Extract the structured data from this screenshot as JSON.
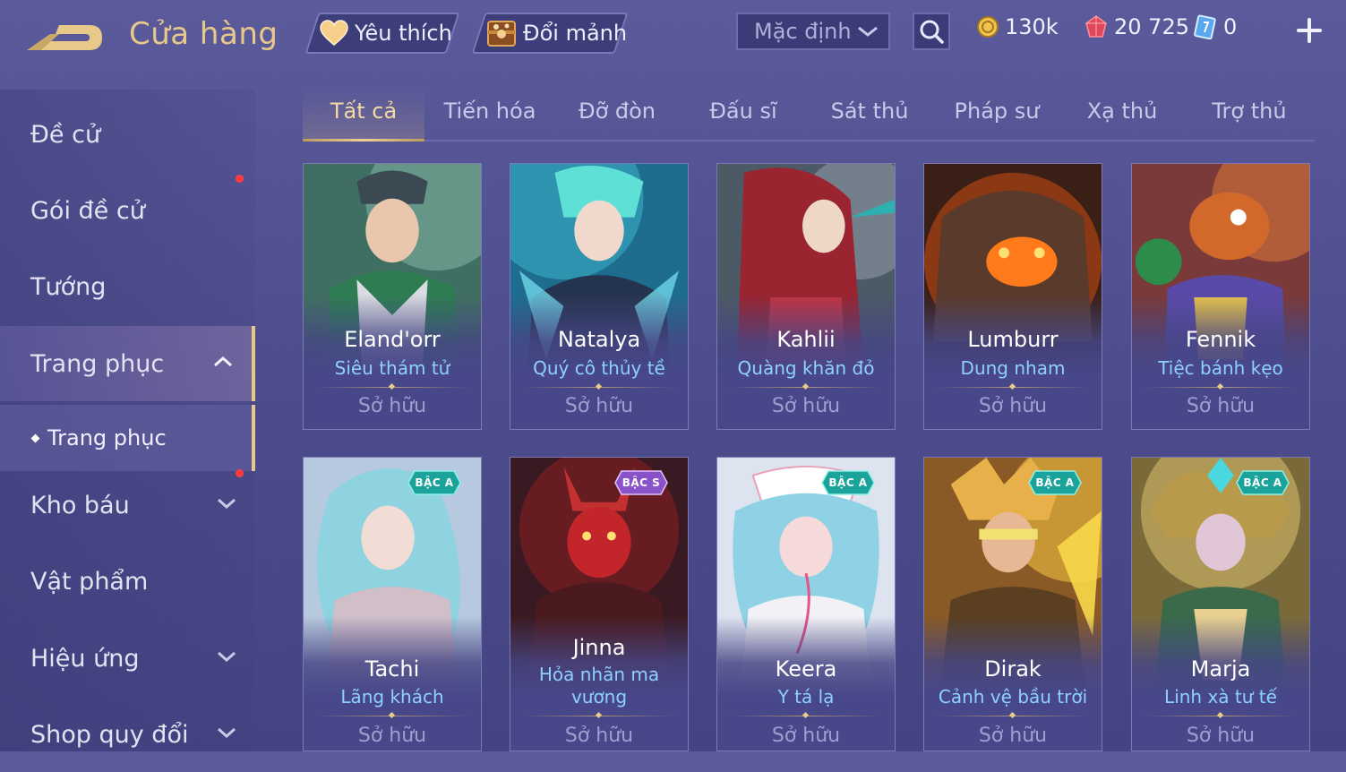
{
  "header": {
    "title": "Cửa hàng",
    "favorite_label": "Yêu thích",
    "exchange_label": "Đổi mảnh",
    "sort_value": "Mặc định",
    "gold": "130k",
    "ruby": "20 725",
    "ticket": "0"
  },
  "sidebar": {
    "items": [
      {
        "label": "Đề cử"
      },
      {
        "label": "Gói đề cử"
      },
      {
        "label": "Tướng"
      },
      {
        "label": "Trang phục"
      },
      {
        "label": "Kho báu"
      },
      {
        "label": "Vật phẩm"
      },
      {
        "label": "Hiệu ứng"
      },
      {
        "label": "Shop quy đổi"
      }
    ],
    "sub_item": "Trang phục"
  },
  "tabs": [
    "Tất cả",
    "Tiến hóa",
    "Đỡ đòn",
    "Đấu sĩ",
    "Sát thủ",
    "Pháp sư",
    "Xạ thủ",
    "Trợ thủ"
  ],
  "cards": [
    {
      "hero": "Eland'orr",
      "skin": "Siêu thám tử",
      "status": "Sở hữu"
    },
    {
      "hero": "Natalya",
      "skin": "Quý cô thủy tề",
      "status": "Sở hữu"
    },
    {
      "hero": "Kahlii",
      "skin": "Quàng khăn đỏ",
      "status": "Sở hữu"
    },
    {
      "hero": "Lumburr",
      "skin": "Dung nham",
      "status": "Sở hữu"
    },
    {
      "hero": "Fennik",
      "skin": "Tiệc bánh kẹo",
      "status": "Sở hữu"
    },
    {
      "hero": "Tachi",
      "skin": "Lãng khách",
      "status": "Sở hữu",
      "badge": "BẬC A"
    },
    {
      "hero": "Jinna",
      "skin": "Hỏa nhãn ma vương",
      "status": "Sở hữu",
      "badge": "BẬC S"
    },
    {
      "hero": "Keera",
      "skin": "Y tá lạ",
      "status": "Sở hữu",
      "badge": "BẬC A"
    },
    {
      "hero": "Dirak",
      "skin": "Cảnh vệ bầu trời",
      "status": "Sở hữu",
      "badge": "BẬC A"
    },
    {
      "hero": "Marja",
      "skin": "Linh xà tư tế",
      "status": "Sở hữu",
      "badge": "BẬC A"
    }
  ],
  "colors": {
    "accent_gold": "#e8c98a",
    "skin_blue": "#8fd0ff",
    "badge_a": "#1aa39a",
    "badge_s": "#8a52c8",
    "notify_dot": "#ff3b3b"
  }
}
